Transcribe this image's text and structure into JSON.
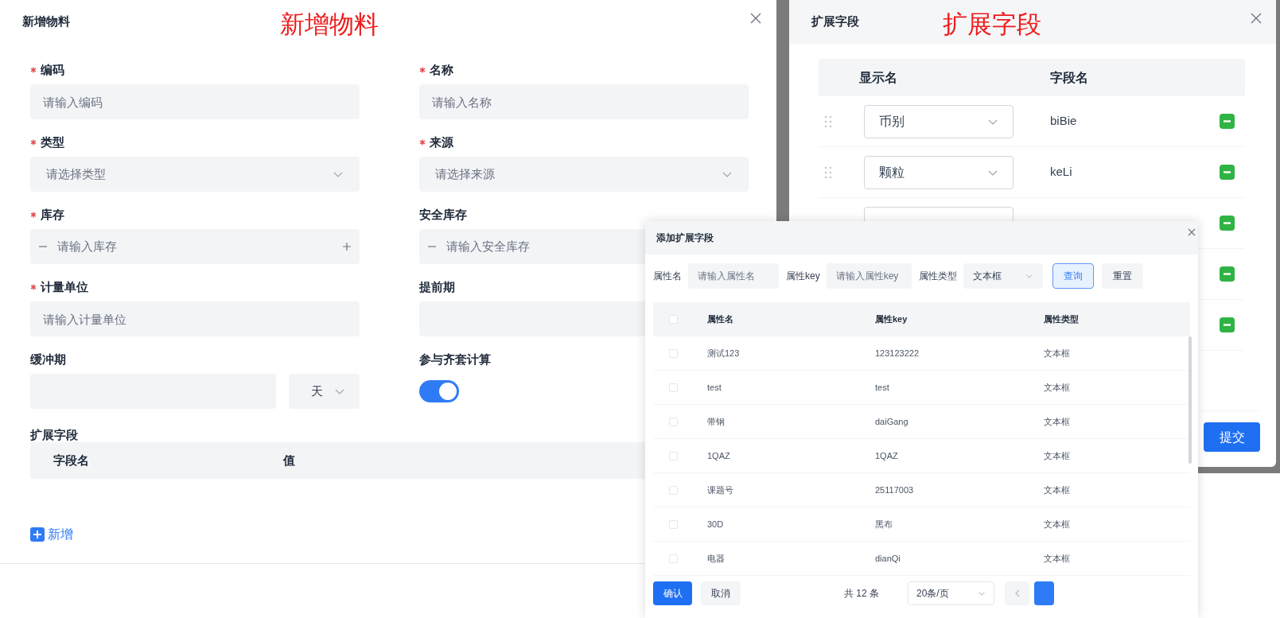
{
  "material_dialog": {
    "title": "新增物料",
    "annotation": "新增物料",
    "fields": [
      {
        "kind": "input",
        "label": "编码",
        "required": true,
        "placeholder": "请输入编码"
      },
      {
        "kind": "input",
        "label": "名称",
        "required": true,
        "placeholder": "请输入名称"
      },
      {
        "kind": "select",
        "label": "类型",
        "required": true,
        "placeholder": "请选择类型"
      },
      {
        "kind": "select",
        "label": "来源",
        "required": true,
        "placeholder": "请选择来源"
      },
      {
        "kind": "number",
        "label": "库存",
        "required": true,
        "placeholder": "请输入库存",
        "steppers": [
          {
            "kind": "minus"
          },
          {
            "kind": "plus"
          }
        ]
      },
      {
        "kind": "number",
        "label": "安全库存",
        "required": false,
        "placeholder": "请输入安全库存",
        "steppers": [
          {
            "kind": "minus"
          }
        ]
      },
      {
        "kind": "input",
        "label": "计量单位",
        "required": true,
        "placeholder": "请输入计量单位"
      },
      {
        "kind": "input",
        "label": "提前期",
        "required": false
      },
      {
        "kind": "input_unit",
        "label": "缓冲期",
        "required": false,
        "unit": "天"
      },
      {
        "kind": "switch",
        "label": "参与齐套计算",
        "required": false,
        "on": true
      }
    ],
    "extension": {
      "label": "扩展字段",
      "columns": [
        "字段名",
        "值"
      ]
    },
    "add_button": "新增"
  },
  "extension_dialog": {
    "title": "扩展字段",
    "annotation": "扩展字段",
    "columns": [
      "显示名",
      "字段名"
    ],
    "rows": [
      {
        "kind": "row",
        "display_name": "币别",
        "field_name": "biBie"
      },
      {
        "kind": "row",
        "display_name": "颗粒",
        "field_name": "keLi"
      },
      {
        "kind": "covered"
      },
      {
        "kind": "minus_only"
      },
      {
        "kind": "minus_only"
      }
    ],
    "submit": "提交"
  },
  "add_field_dialog": {
    "title": "添加扩展字段",
    "filters": [
      {
        "kind": "input",
        "label": "属性名",
        "placeholder": "请输入属性名"
      },
      {
        "kind": "input",
        "label": "属性key",
        "placeholder": "请输入属性key"
      },
      {
        "kind": "select",
        "label": "属性类型",
        "value": "文本框"
      }
    ],
    "query_button": "查询",
    "reset_button": "重置",
    "columns": [
      "属性名",
      "属性key",
      "属性类型"
    ],
    "select_all_checked": false,
    "rows": [
      {
        "name": "测试123",
        "key": "123123222",
        "type": "文本框",
        "checked": false
      },
      {
        "name": "test",
        "key": "test",
        "type": "文本框",
        "checked": false
      },
      {
        "name": "带钢",
        "key": "daiGang",
        "type": "文本框",
        "checked": false
      },
      {
        "name": "1QAZ",
        "key": "1QAZ",
        "type": "文本框",
        "checked": false
      },
      {
        "name": "课题号",
        "key": "25117003",
        "type": "文本框",
        "checked": false
      },
      {
        "name": "30D",
        "key": "黑布",
        "type": "文本框",
        "checked": false
      },
      {
        "name": "电器",
        "key": "dianQi",
        "type": "文本框",
        "checked": false
      }
    ],
    "confirm_button": "确认",
    "cancel_button": "取消",
    "total": "共 12 条",
    "page_size": "20条/页"
  }
}
